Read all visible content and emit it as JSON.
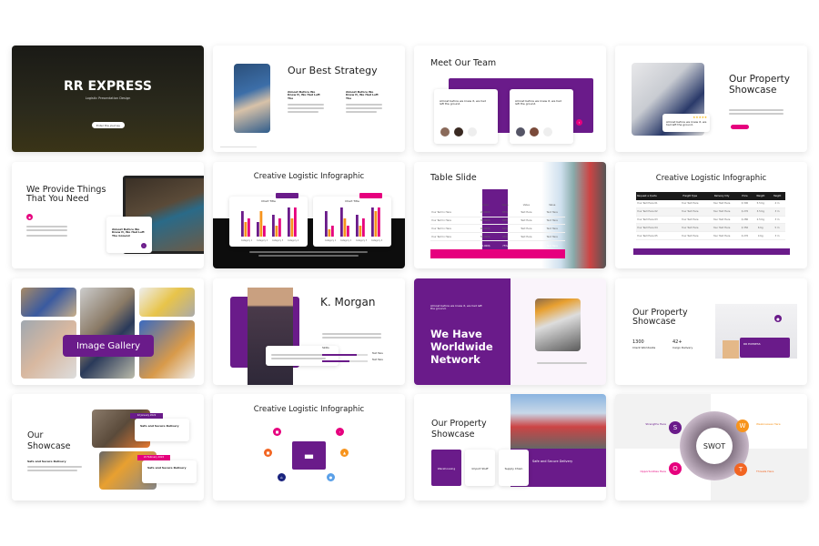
{
  "colors": {
    "purple": "#6a1b8a",
    "pink": "#e6007e",
    "orange": "#f7941d",
    "dark": "#111111"
  },
  "s1": {
    "title": "RR EXPRESS",
    "subtitle": "Logistic Presentation Design",
    "button": "Enter the journey"
  },
  "s2": {
    "title": "Our Best Strategy",
    "col1": "Almost Before We Knew It, We Had Left The",
    "col2": "Almost Before We Knew It, We Had Left The"
  },
  "s3": {
    "title": "Meet Our Team",
    "card1": "Almost before we knew it, we had left the ground.",
    "card2": "Almost before we knew it, we had left the ground."
  },
  "s4": {
    "title": "Our Property Showcase",
    "quote": "Almost before we knew it, we had left the ground.",
    "stars": "★★★★★"
  },
  "s5": {
    "title": "We Provide Things That You Need",
    "card": "Almost Before We Knew It, We Had Left The Ground"
  },
  "s6": {
    "title": "Creative Logistic Infographic",
    "chart_titles": [
      "Chart Title",
      "Chart Title"
    ],
    "categories": [
      "Category 1",
      "Category 2",
      "Category 3",
      "Category 4"
    ]
  },
  "s7": {
    "title": "Table Slide",
    "header": [
      "",
      "Value",
      "Value",
      "Value",
      "Value"
    ],
    "rows": [
      [
        "Your Text In Here",
        "20.000$",
        "85%",
        "Text Here",
        "Text Here"
      ],
      [
        "Your Text In Here",
        "30.000$",
        "80%",
        "Text Here",
        "Text Here"
      ],
      [
        "Your Text In Here",
        "40.000$",
        "60%",
        "Text Here",
        "Text Here"
      ],
      [
        "Your Text In Here",
        "50.000$",
        "95%",
        "Text Here",
        "Text Here"
      ]
    ],
    "total": [
      "TOTAL",
      "40.000$",
      "75%",
      "Text Here",
      "Text Here"
    ]
  },
  "s8": {
    "title": "Creative Logistic Infographic",
    "header": [
      "Request a Quote",
      "Freight Type",
      "Delivery City",
      "Price",
      "Weight",
      "Height"
    ],
    "rows": [
      [
        "Your Text Here 01",
        "Your Text Here",
        "Your Text Here",
        "$ 300",
        "5.5 Kg",
        "4 m"
      ],
      [
        "Your Text Here 02",
        "Your Text Here",
        "Your Text Here",
        "$ 270",
        "3.5 Kg",
        "3 m"
      ],
      [
        "Your Text Here 03",
        "Your Text Here",
        "Your Text Here",
        "$ 280",
        "2.5 Kg",
        "3 m"
      ],
      [
        "Your Text Here 04",
        "Your Text Here",
        "Your Text Here",
        "$ 350",
        "6 Kg",
        "5 m"
      ],
      [
        "Your Text Here 05",
        "Your Text Here",
        "Your Text Here",
        "$ 270",
        "4 Kg",
        "3 m"
      ]
    ]
  },
  "s9": {
    "title": "Image Gallery"
  },
  "s10": {
    "title": "K. Morgan",
    "skills": "Skills",
    "skill_labels": [
      "Text Here",
      "Text Here"
    ],
    "skill_levels": [
      0.75,
      0.6
    ]
  },
  "s11": {
    "title": "We Have Worldwide Network",
    "intro": "Almost before we knew it, we had left the ground."
  },
  "s12": {
    "title": "Our Property Showcase",
    "stats": [
      {
        "value": "1300",
        "label": "Client Worldwide"
      },
      {
        "value": "42+",
        "label": "Cargo Delivery"
      }
    ],
    "truck_label": "RR EXPRESS"
  },
  "s13": {
    "title": "Our Showcase",
    "subtitle": "Safe and Secure Delivery",
    "date1": "12 January 2022",
    "date2": "22 February 2022",
    "card1": "Safe and Secure Delivery",
    "card2": "Safe and Secure Delivery"
  },
  "s14": {
    "title": "Creative Logistic Infographic"
  },
  "s15": {
    "title": "Our Property Showcase",
    "boxes": [
      "Warehousing",
      "Import Stuff",
      "Supply Chain"
    ],
    "banner": "Safe and Secure Delivery"
  },
  "s16": {
    "center": "SWOT",
    "letters": [
      "S",
      "W",
      "O",
      "T"
    ],
    "labels": [
      "Strengths Here",
      "Weaknesses Here",
      "Opportunities Here",
      "Threats Here"
    ]
  }
}
